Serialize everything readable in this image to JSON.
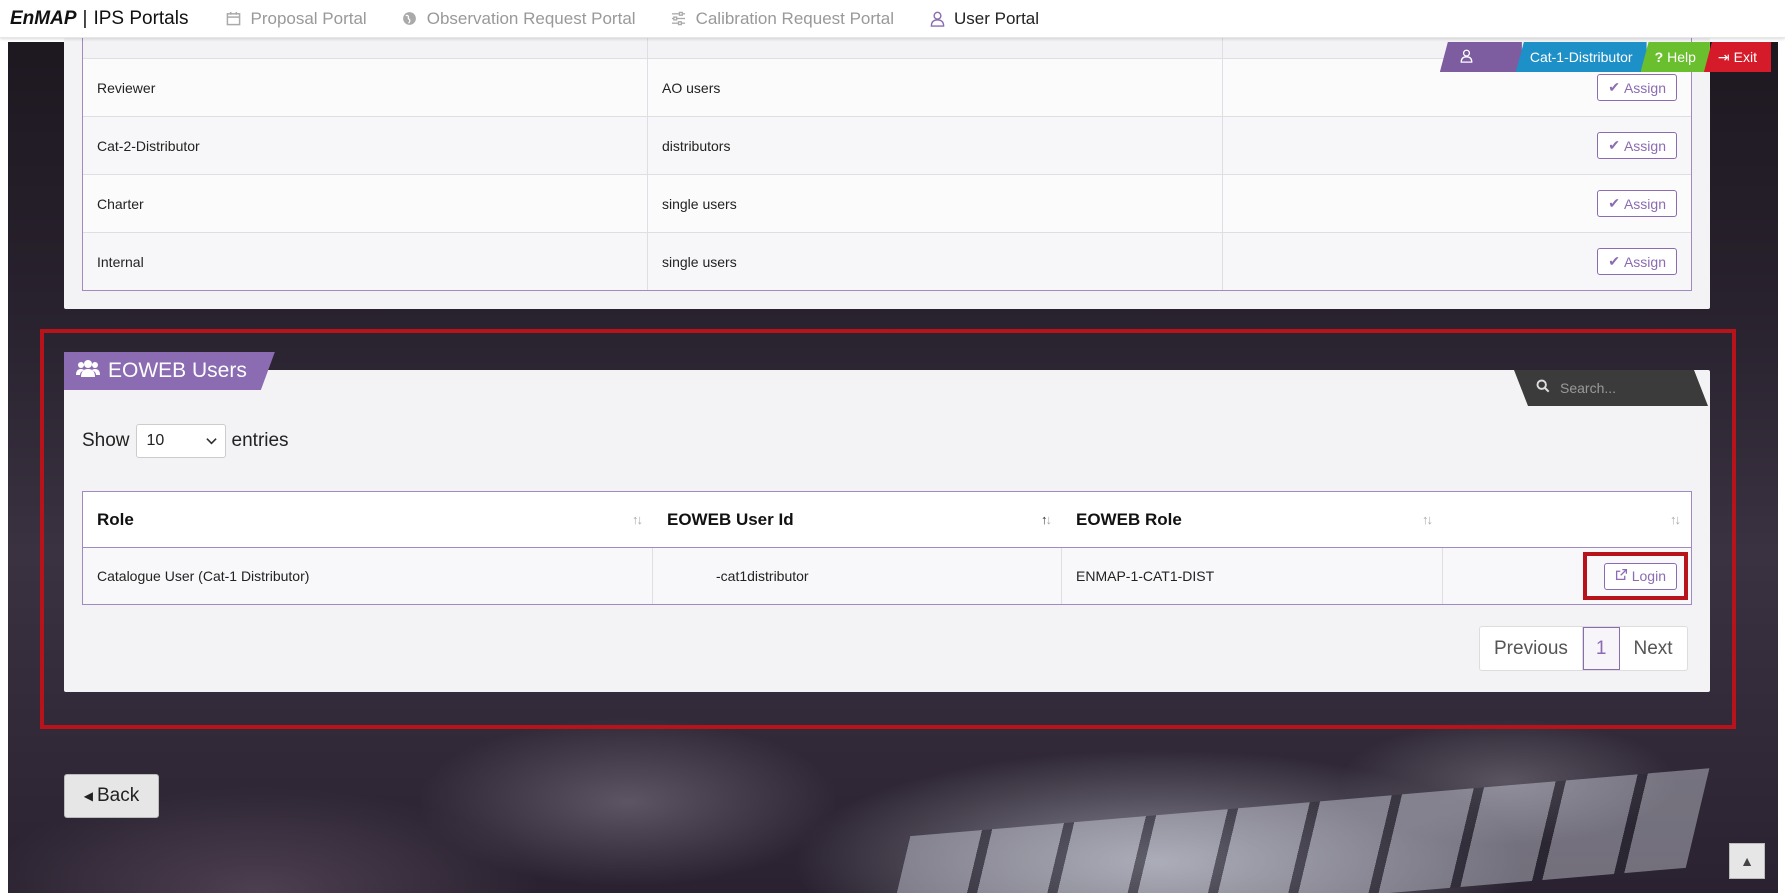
{
  "navbar": {
    "brand_bold": "EnMAP",
    "brand_sep": "|",
    "brand_rest": "IPS Portals",
    "items": [
      {
        "label": "Proposal Portal",
        "icon": "calendar-icon",
        "active": false
      },
      {
        "label": "Observation Request Portal",
        "icon": "globe-icon",
        "active": false
      },
      {
        "label": "Calibration Request Portal",
        "icon": "sliders-icon",
        "active": false
      },
      {
        "label": "User Portal",
        "icon": "user-icon",
        "active": true
      }
    ]
  },
  "ribbon": {
    "role": "Cat-1-Distributor",
    "help": "Help",
    "exit": "Exit",
    "colors": {
      "user": "#7d5ca0",
      "role": "#1e90c8",
      "help": "#6abf2e",
      "exit": "#d51b2a"
    }
  },
  "roles_table": {
    "assign_label": "Assign",
    "rows": [
      {
        "role": "Reviewer",
        "group": "AO users"
      },
      {
        "role": "Cat-2-Distributor",
        "group": "distributors"
      },
      {
        "role": "Charter",
        "group": "single users"
      },
      {
        "role": "Internal",
        "group": "single users"
      }
    ]
  },
  "eoweb": {
    "title": "EOWEB Users",
    "search_placeholder": "Search...",
    "show_label": "Show",
    "entries_value": "10",
    "entries_label": "entries",
    "columns": [
      "Role",
      "EOWEB User Id",
      "EOWEB Role",
      ""
    ],
    "rows": [
      {
        "role": "Catalogue User (Cat-1 Distributor)",
        "user_id": "-cat1distributor",
        "eoweb_role": "ENMAP-1-CAT1-DIST",
        "action": "Login"
      }
    ],
    "pager": {
      "previous": "Previous",
      "current": "1",
      "next": "Next"
    }
  },
  "back_label": "Back",
  "accent_color": "#8b6bb1",
  "highlight_color": "#b8121a"
}
